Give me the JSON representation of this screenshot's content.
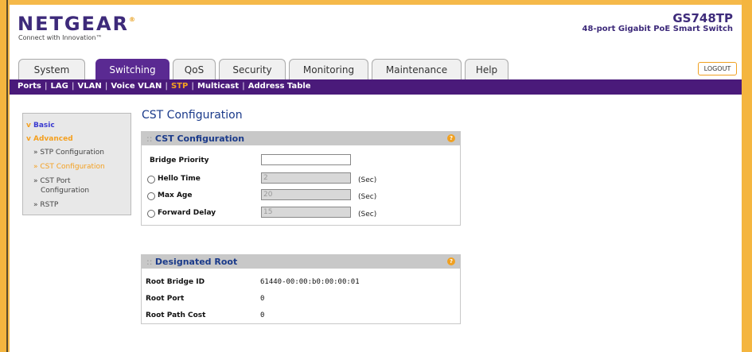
{
  "brand": {
    "logo": "NETGEAR",
    "tagline": "Connect with Innovation™",
    "model": "GS748TP",
    "model_desc": "48-port Gigabit PoE Smart Switch"
  },
  "tabs": [
    {
      "label": "System"
    },
    {
      "label": "Switching"
    },
    {
      "label": "QoS"
    },
    {
      "label": "Security"
    },
    {
      "label": "Monitoring"
    },
    {
      "label": "Maintenance"
    },
    {
      "label": "Help"
    }
  ],
  "logout_label": "LOGOUT",
  "subnav": [
    "Ports",
    "LAG",
    "VLAN",
    "Voice VLAN",
    "STP",
    "Multicast",
    "Address Table"
  ],
  "sidemenu": {
    "basic": "Basic",
    "advanced": "Advanced",
    "items": [
      "» STP Configuration",
      "» CST Configuration",
      "» CST Port",
      "Configuration",
      "» RSTP"
    ]
  },
  "page_title": "CST Configuration",
  "cst": {
    "title": "CST Configuration",
    "bridge_priority_label": "Bridge Priority",
    "bridge_priority_value": "",
    "hello_time_label": "Hello Time",
    "hello_time_value": "2",
    "max_age_label": "Max Age",
    "max_age_value": "20",
    "forward_delay_label": "Forward Delay",
    "forward_delay_value": "15",
    "unit": "(Sec)"
  },
  "designated": {
    "title": "Designated Root",
    "root_bridge_id_label": "Root Bridge ID",
    "root_bridge_id_value": "61440-00:00:b0:00:00:01",
    "root_port_label": "Root Port",
    "root_port_value": "0",
    "root_path_cost_label": "Root Path Cost",
    "root_path_cost_value": "0"
  },
  "colors": {
    "accent": "#5a2a92",
    "highlight": "#f4a020",
    "title_blue": "#1a3a8a"
  }
}
